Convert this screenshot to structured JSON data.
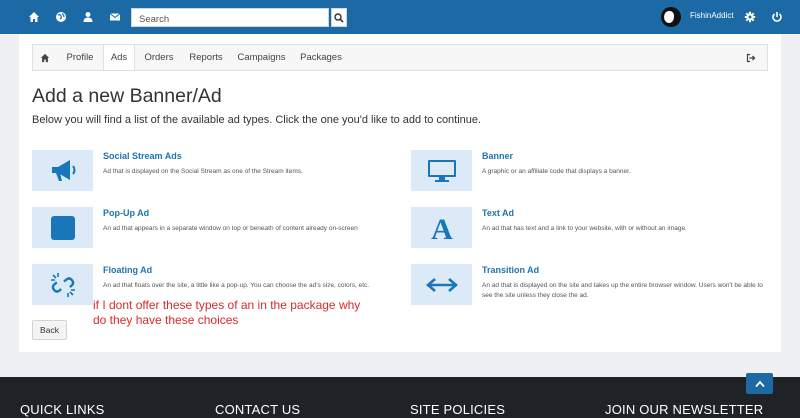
{
  "search": {
    "placeholder": "Search"
  },
  "user": {
    "name": "FishinAddict"
  },
  "tabs": [
    {
      "label": "Profile"
    },
    {
      "label": "Ads"
    },
    {
      "label": "Orders"
    },
    {
      "label": "Reports"
    },
    {
      "label": "Campaigns"
    },
    {
      "label": "Packages"
    }
  ],
  "page": {
    "title": "Add a new Banner/Ad",
    "intro": "Below you will find a list of the available ad types. Click the one you'd like to add to continue."
  },
  "ad_types": [
    {
      "title": "Social Stream Ads",
      "description": "Ad that is displayed on the Social Stream as one of the Stream items.",
      "icon": "megaphone-icon"
    },
    {
      "title": "Banner",
      "description": "A graphic or an affiliate code that displays a banner.",
      "icon": "monitor-icon"
    },
    {
      "title": "Pop-Up Ad",
      "description": "An ad that appears in a separate window on top or beneath of content already on-screen",
      "icon": "square-icon"
    },
    {
      "title": "Text Ad",
      "description": "An ad that has text and a link to your website, with or without an image.",
      "icon": "letter-a-icon"
    },
    {
      "title": "Floating Ad",
      "description": "An ad that floats over the site, a little like a pop-up. You can choose the ad's size, colors, etc.",
      "icon": "broken-link-icon"
    },
    {
      "title": "Transition Ad",
      "description": "An ad that is displayed on the site and takes up the entire browser window. Users won't be able to see the site unless they close the ad.",
      "icon": "arrows-horizontal-icon"
    }
  ],
  "annotation": "if I dont offer these types of an in the package why do they have these choices",
  "back_label": "Back",
  "footer": {
    "headings": [
      "QUICK LINKS",
      "CONTACT US",
      "SITE POLICIES",
      "JOIN OUR NEWSLETTER"
    ]
  },
  "colors": {
    "brand": "#1b6aa5",
    "link": "#1f74ad",
    "icon_bg": "#dbeaf6",
    "annotation": "#d62b2b",
    "footer": "#1f2226"
  }
}
